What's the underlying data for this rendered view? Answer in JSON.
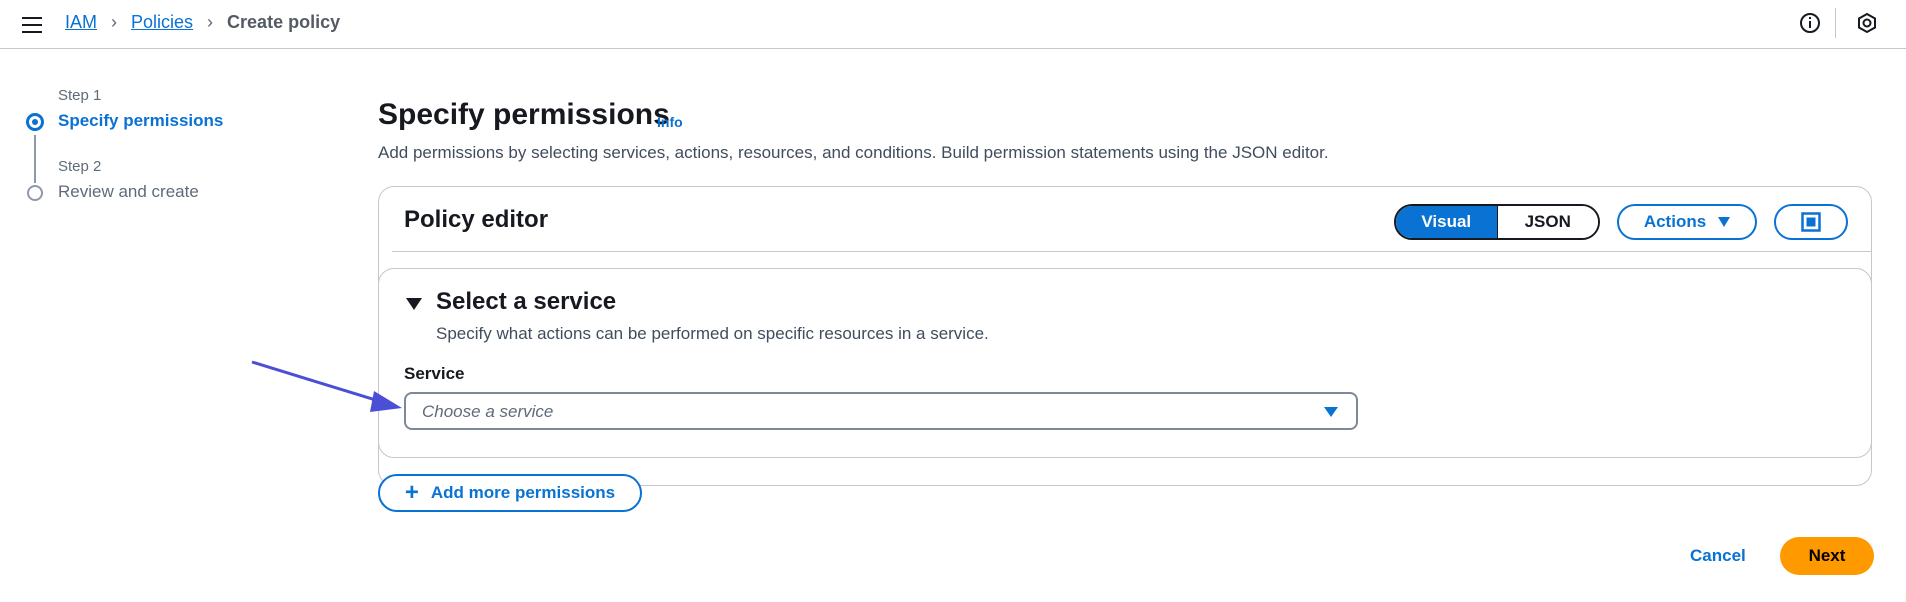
{
  "breadcrumb": {
    "items": [
      "IAM",
      "Policies"
    ],
    "current": "Create policy"
  },
  "steps": [
    {
      "sub": "Step 1",
      "title": "Specify permissions",
      "state": "active"
    },
    {
      "sub": "Step 2",
      "title": "Review and create",
      "state": "pending"
    }
  ],
  "page": {
    "title": "Specify permissions",
    "info": "Info",
    "description": "Add permissions by selecting services, actions, resources, and conditions. Build permission statements using the JSON editor."
  },
  "editor": {
    "title": "Policy editor",
    "tabs": [
      {
        "label": "Visual",
        "active": true
      },
      {
        "label": "JSON",
        "active": false
      }
    ],
    "actions_label": "Actions"
  },
  "service_section": {
    "title": "Select a service",
    "description": "Specify what actions can be performed on specific resources in a service.",
    "field_label": "Service",
    "placeholder": "Choose a service"
  },
  "add_permissions_label": "Add more permissions",
  "footer": {
    "cancel": "Cancel",
    "next": "Next"
  },
  "colors": {
    "primary": "#0972d3",
    "next": "#ff9900",
    "annotation_arrow": "#4b4fd6"
  },
  "icons": [
    "menu-icon",
    "info-circle-icon",
    "settings-hex-icon",
    "fullscreen-icon",
    "plus-icon",
    "caret-down-icon"
  ]
}
